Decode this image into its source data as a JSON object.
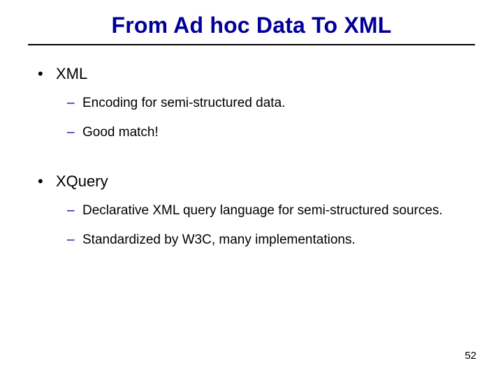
{
  "title": "From Ad hoc Data To XML",
  "bullets": {
    "b1": "XML",
    "b1s1": "Encoding for semi-structured data.",
    "b1s2": "Good match!",
    "b2": "XQuery",
    "b2s1": "Declarative XML query language for semi-structured sources.",
    "b2s2": "Standardized by W3C, many implementations."
  },
  "page_number": "52"
}
